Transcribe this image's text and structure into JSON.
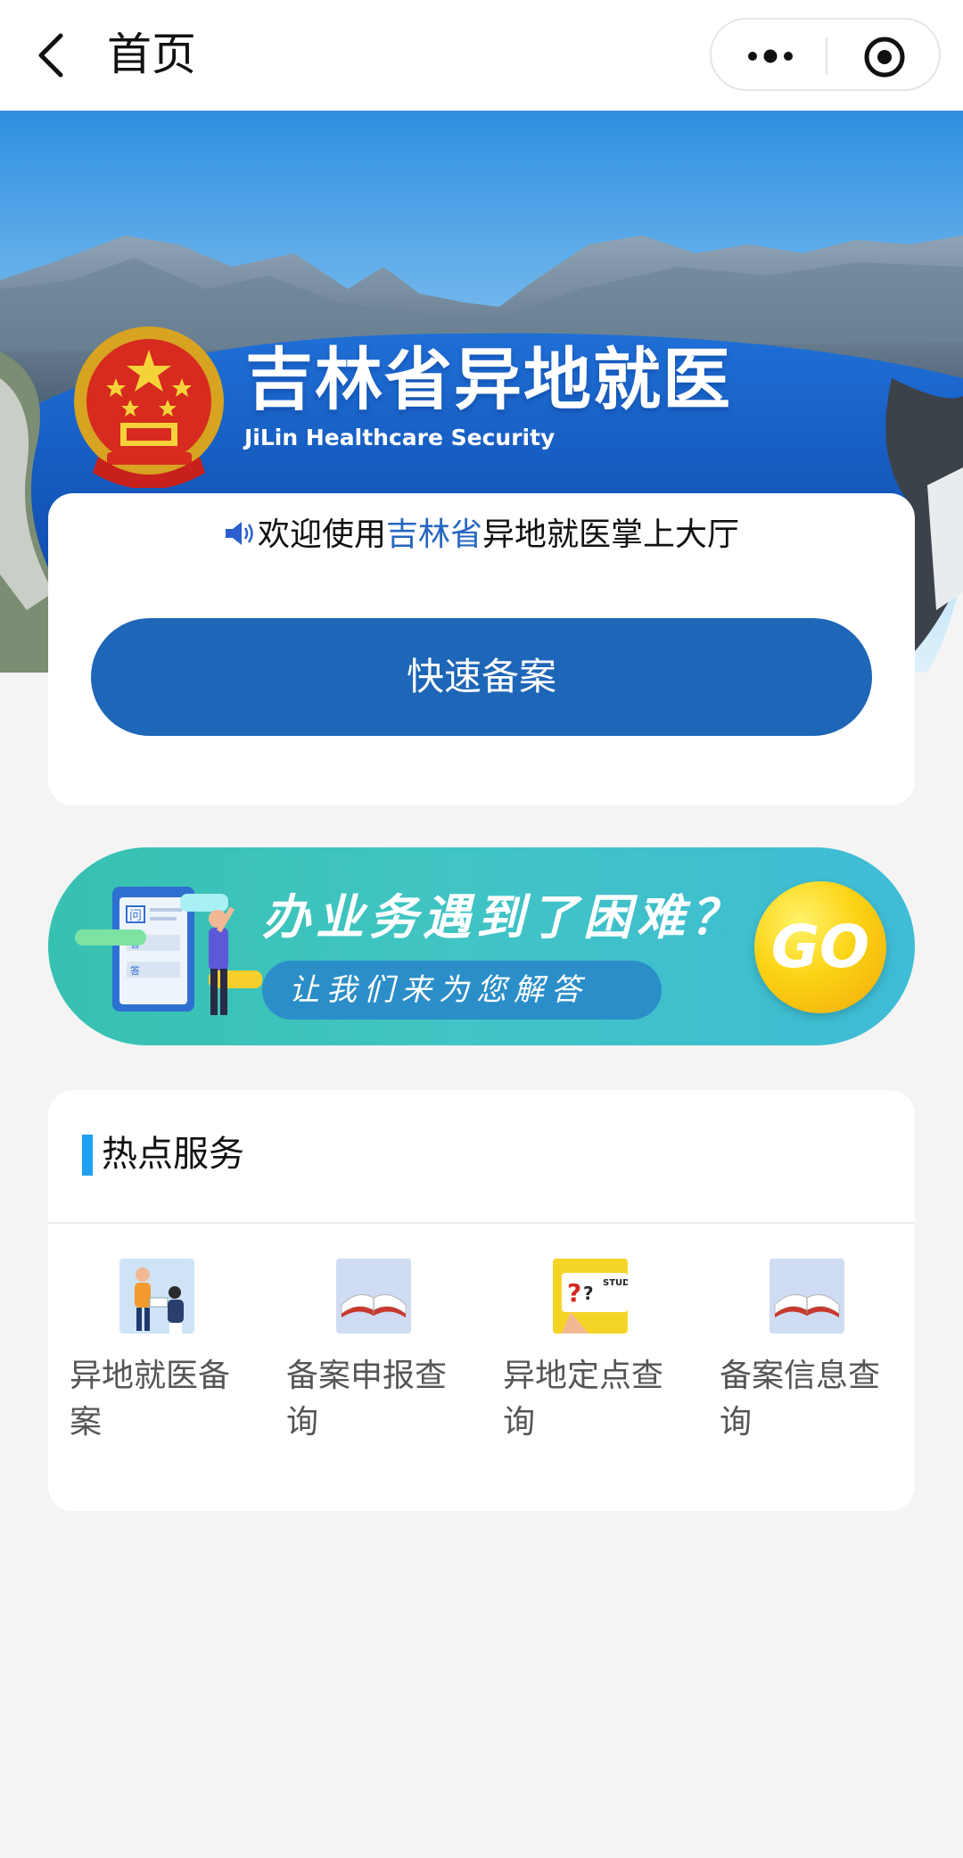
{
  "navbar": {
    "title": "首页"
  },
  "banner": {
    "title": "吉林省异地就医",
    "subtitle": "JiLin Healthcare Security"
  },
  "welcome": {
    "prefix": "欢迎使用",
    "highlight": "吉林省",
    "suffix": "异地就医掌上大厅",
    "highlight_color": "#2566c0"
  },
  "quick_filing": {
    "label": "快速备案",
    "color": "#1e66b7"
  },
  "help_banner": {
    "title": "办业务遇到了困难？",
    "subtitle": "让我们来为您解答",
    "go_label": "GO",
    "card_q": "问",
    "card_a": "答"
  },
  "hot_services": {
    "title": "热点服务",
    "accent_color": "#1ea1f2",
    "items": [
      {
        "label": "异地就医备案",
        "icon": "people-filing-icon"
      },
      {
        "label": "备案申报查询",
        "icon": "open-book-icon"
      },
      {
        "label": "异地定点查询",
        "icon": "question-card-icon",
        "icon_text": "STUD ABO"
      },
      {
        "label": "备案信息查询",
        "icon": "open-book-icon"
      }
    ]
  }
}
